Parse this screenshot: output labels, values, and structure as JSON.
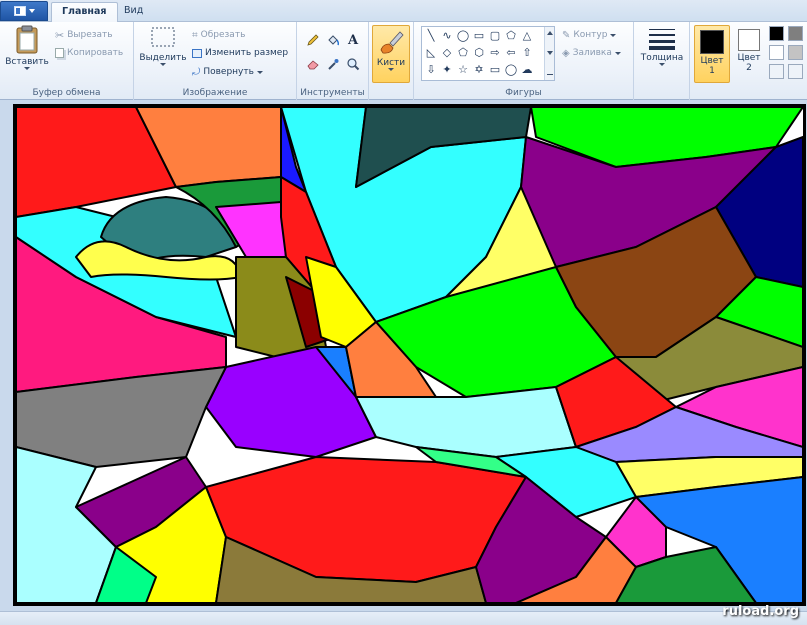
{
  "tabs": {
    "home": "Главная",
    "view": "Вид"
  },
  "clipboard": {
    "paste_label": "Вставить",
    "cut_label": "Вырезать",
    "copy_label": "Копировать",
    "group_label": "Буфер обмена"
  },
  "image": {
    "select_label": "Выделить",
    "crop_label": "Обрезать",
    "resize_label": "Изменить размер",
    "rotate_label": "Повернуть",
    "group_label": "Изображение"
  },
  "tools": {
    "group_label": "Инструменты"
  },
  "brushes": {
    "label": "Кисти"
  },
  "shapes": {
    "outline_label": "Контур",
    "fill_label": "Заливка",
    "group_label": "Фигуры"
  },
  "size": {
    "label": "Толщина"
  },
  "colors": {
    "color1_label": "Цвет 1",
    "color2_label": "Цвет 2",
    "color1_value": "#000000",
    "color2_value": "#ffffff"
  },
  "watermark": "ruload.org"
}
